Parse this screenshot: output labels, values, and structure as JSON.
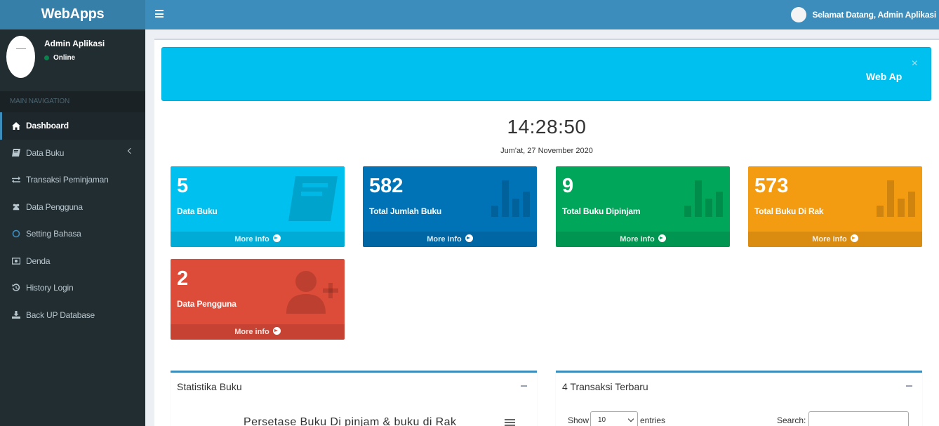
{
  "header": {
    "logo": "WebApps",
    "welcome": "Selamat Datang, Admin Aplikasi"
  },
  "sidebar": {
    "user_name": "Admin Aplikasi",
    "user_status": "Online",
    "nav_header": "MAIN NAVIGATION",
    "items": [
      {
        "label": "Dashboard",
        "icon": "home-icon"
      },
      {
        "label": "Data Buku",
        "icon": "book-icon"
      },
      {
        "label": "Transaksi Peminjaman",
        "icon": "exchange-icon"
      },
      {
        "label": "Data Pengguna",
        "icon": "users-icon"
      },
      {
        "label": "Setting Bahasa",
        "icon": "circle-icon"
      },
      {
        "label": "Denda",
        "icon": "money-icon"
      },
      {
        "label": "History Login",
        "icon": "history-icon"
      },
      {
        "label": "Back UP Database",
        "icon": "download-icon"
      }
    ]
  },
  "callout": {
    "marquee": "Web Ap",
    "close": "×"
  },
  "clock": {
    "time": "14:28:50",
    "date": "Jum'at, 27 November 2020"
  },
  "boxes": [
    {
      "value": "5",
      "label": "Data Buku",
      "more": "More info",
      "color": "#00c0ef"
    },
    {
      "value": "582",
      "label": "Total Jumlah Buku",
      "more": "More info",
      "color": "#0073b7"
    },
    {
      "value": "9",
      "label": "Total Buku Dipinjam",
      "more": "More info",
      "color": "#00a65a"
    },
    {
      "value": "573",
      "label": "Total Buku Di Rak",
      "more": "More info",
      "color": "#f39c12"
    },
    {
      "value": "2",
      "label": "Data Pengguna",
      "more": "More info",
      "color": "#dd4b39"
    }
  ],
  "panels": {
    "stats_title": "Statistika Buku",
    "chart_title": "Persetase Buku Di pinjam & buku di Rak",
    "trans_title": "4 Transaksi Terbaru",
    "show_label": "Show",
    "entries_value": "10",
    "entries_label": "entries",
    "search_label": "Search:"
  }
}
